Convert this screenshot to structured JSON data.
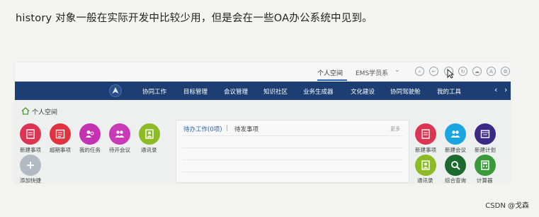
{
  "caption": "history 对象一般在实际开发中比较少用，但是会在一些OA办公系统中见到。",
  "topbar": {
    "space_label": "个人空间",
    "ems_label": "EMS学员系"
  },
  "nav": {
    "items": [
      "协同工作",
      "目标管理",
      "会议管理",
      "知识社区",
      "业务生成器",
      "文化建设",
      "协同驾驶舱",
      "我的工具"
    ]
  },
  "breadcrumb": "个人空间",
  "left_tiles": [
    {
      "label": "新建事项",
      "color": "#dc3553",
      "icon": "doc-icon"
    },
    {
      "label": "超期事项",
      "color": "#e0323f",
      "icon": "list-icon"
    },
    {
      "label": "我的任务",
      "color": "#c431b3",
      "icon": "user-task-icon"
    },
    {
      "label": "待开会议",
      "color": "#c83ab6",
      "icon": "meeting-icon"
    },
    {
      "label": "通讯录",
      "color": "#8cbb25",
      "icon": "contacts-icon"
    },
    {
      "label": "添加快捷",
      "color": "#b3b9c4",
      "icon": "plus-icon"
    }
  ],
  "panel": {
    "tab_active": "待办工作(0项)",
    "separator": "|",
    "tab_pending": "待发事项",
    "more": "更多"
  },
  "right_tiles": [
    {
      "label": "新建事项",
      "color": "#dc3553",
      "icon": "doc-icon"
    },
    {
      "label": "新建会议",
      "color": "#1aa5e0",
      "icon": "meeting-icon"
    },
    {
      "label": "新建计划",
      "color": "#3a2a86",
      "icon": "plan-icon"
    },
    {
      "label": "通讯录",
      "color": "#8cbb25",
      "icon": "contacts-icon"
    },
    {
      "label": "综合查询",
      "color": "#1d6a2f",
      "icon": "search-icon"
    },
    {
      "label": "计算器",
      "color": "#3a9a3a",
      "icon": "calculator-icon"
    }
  ],
  "watermark": "CSDN @戈森"
}
